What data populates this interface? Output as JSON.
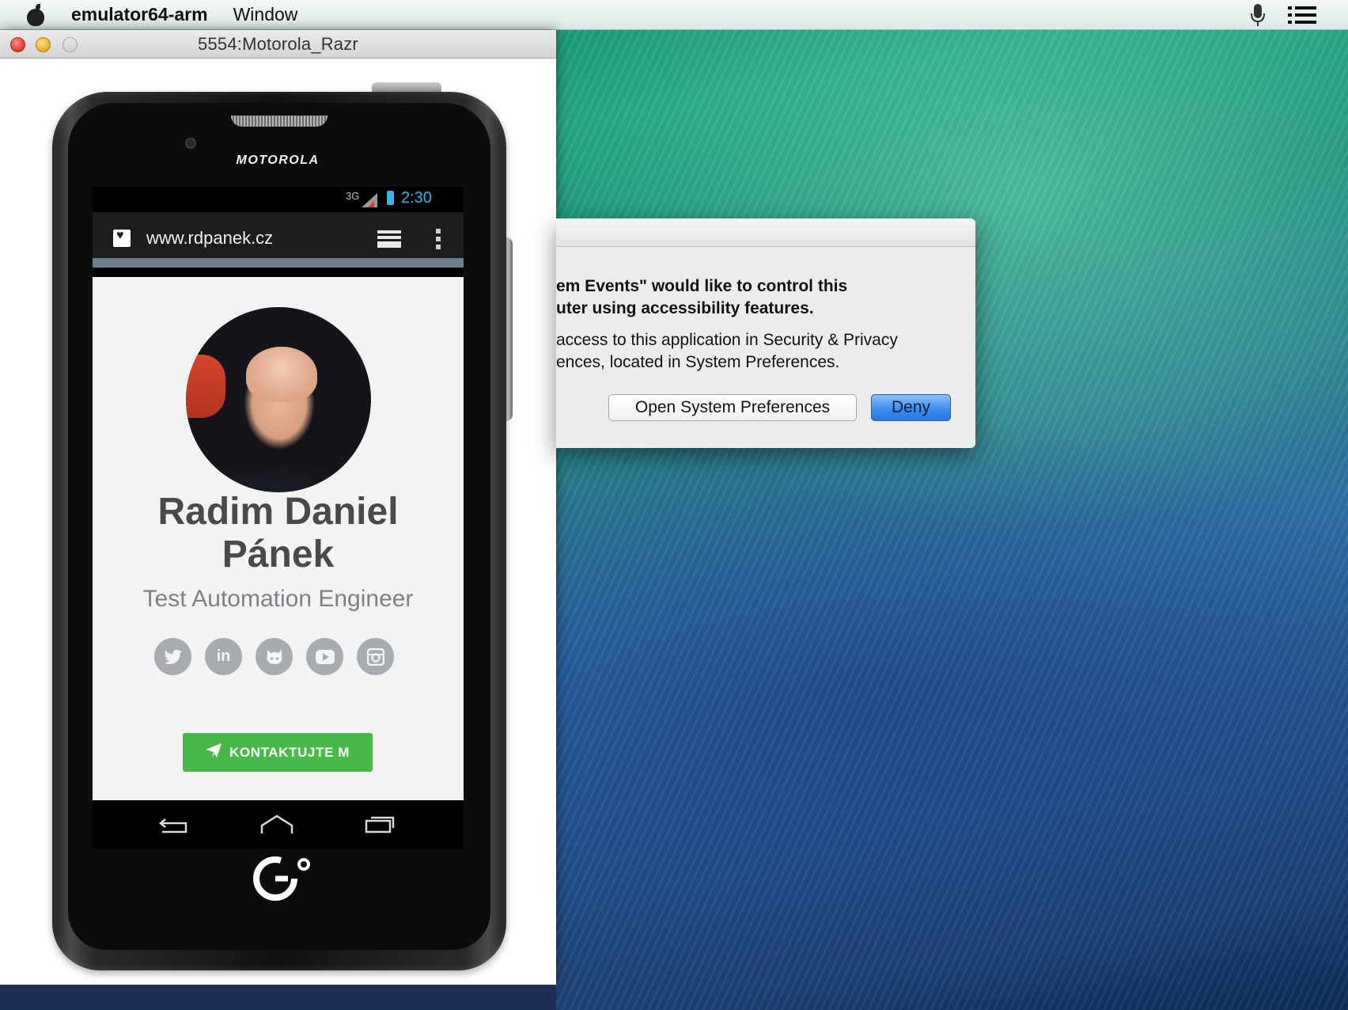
{
  "menubar": {
    "app_name": "emulator64-arm",
    "items": [
      "Window"
    ]
  },
  "emulator_window": {
    "title": "5554:Motorola_Razr"
  },
  "phone": {
    "brand": "MOTOROLA",
    "status": {
      "network": "3G",
      "time": "2:30"
    },
    "browser": {
      "url": "www.rdpanek.cz"
    },
    "profile": {
      "name_line1": "Radim Daniel",
      "name_line2": "Pánek",
      "job_title": "Test Automation Engineer",
      "social_icons": [
        "twitter-icon",
        "linkedin-icon",
        "github-icon",
        "youtube-icon",
        "instagram-icon"
      ],
      "linkedin_text": "in",
      "contact_button": "KONTAKTUJTE M"
    }
  },
  "dialog": {
    "line1": "em Events\" would like to control this",
    "line2": "uter using accessibility features.",
    "line3": "access to this application in Security & Privacy",
    "line4": "ences, located in System Preferences.",
    "open_button": "Open System Preferences",
    "deny_button": "Deny"
  },
  "colors": {
    "accent_blue": "#33b5e5",
    "contact_green": "#49b84a",
    "deny_blue": "#3d8ef0",
    "social_gray": "#a8acb0"
  }
}
